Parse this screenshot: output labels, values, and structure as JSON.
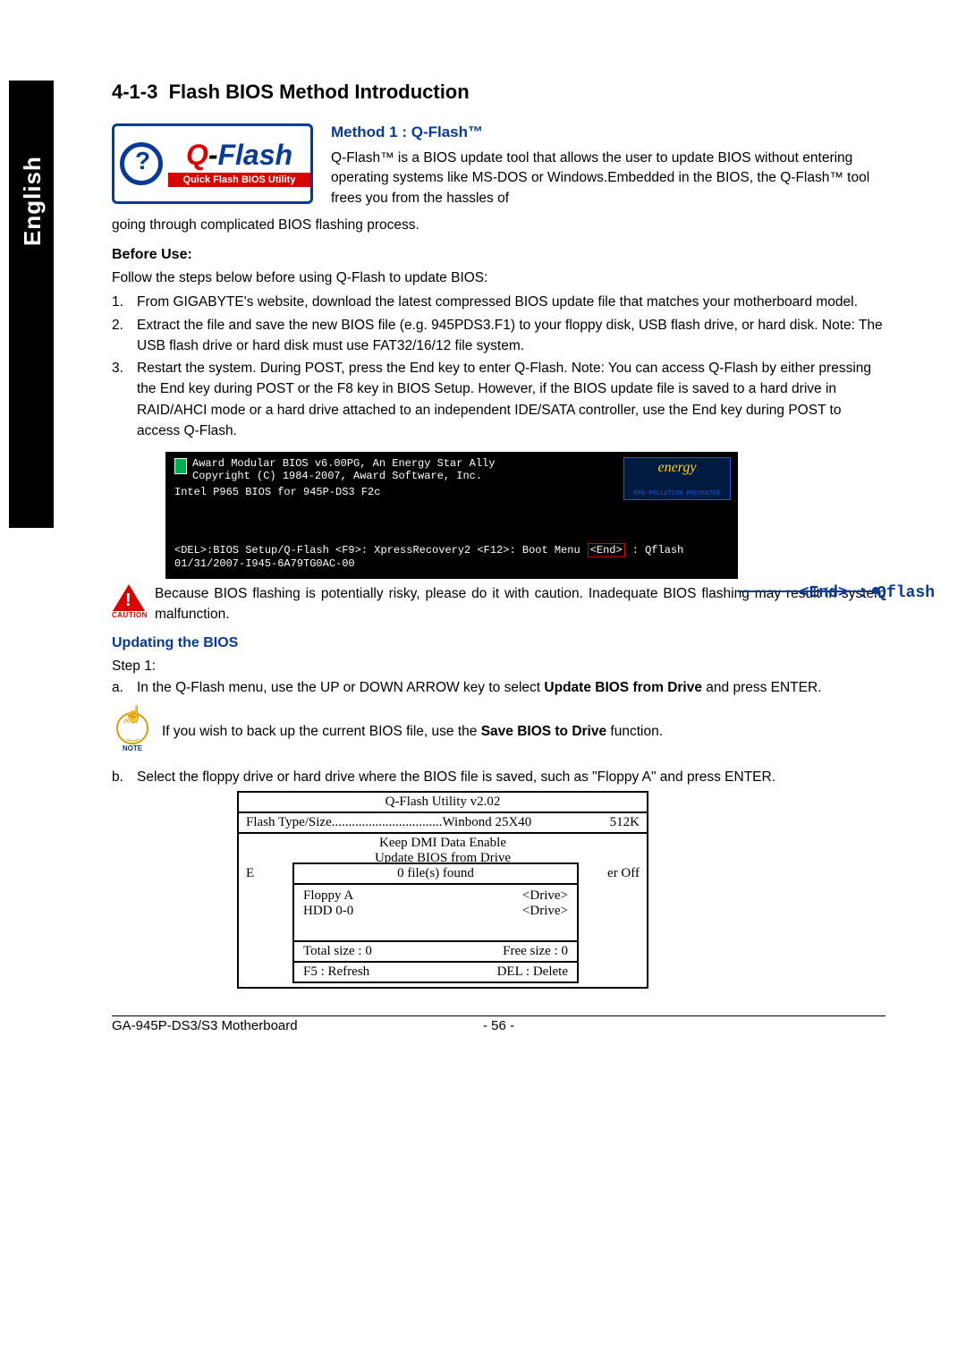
{
  "section_number": "4-1-3",
  "section_title": "Flash BIOS Method Introduction",
  "language_tab": "English",
  "logo": {
    "name_q": "Q",
    "name_flash": "Flash",
    "subtitle": "Quick Flash BIOS Utility"
  },
  "method1": {
    "heading": "Method 1 : Q-Flash™",
    "para_a": "Q-Flash™ is a BIOS update tool that allows the user to update BIOS without entering operating systems like MS-DOS or Windows.Embedded in the BIOS, the Q-Flash™ tool frees you from the hassles of",
    "para_b": "going through complicated BIOS flashing process."
  },
  "before_use": {
    "heading": "Before Use:",
    "intro": "Follow the steps below before using Q-Flash to update BIOS:",
    "items": [
      "From GIGABYTE's website, download the latest compressed BIOS update file that matches your motherboard model.",
      "Extract the file and save the new BIOS file (e.g. 945PDS3.F1) to your floppy disk, USB flash drive, or hard disk. Note: The USB flash drive or hard disk must use FAT32/16/12 file system.",
      "Restart the system. During POST, press the End key to enter Q-Flash.  Note: You can access Q-Flash by either pressing the End key during POST or the F8 key in BIOS Setup. However, if the BIOS update file is saved to a hard drive in RAID/AHCI mode or a hard drive attached to an independent IDE/SATA controller, use the End key during POST to access Q-Flash."
    ]
  },
  "bios_screen": {
    "line1": "Award Modular BIOS v6.00PG, An Energy Star Ally",
    "line2": "Copyright (C) 1984-2007, Award Software, Inc.",
    "line3": "Intel P965 BIOS for 945P-DS3 F2c",
    "bottom_pre": "<DEL>:BIOS Setup/Q-Flash <F9>: XpressRecovery2 <F12>: Boot Menu",
    "bottom_end": "<End>",
    "bottom_post": ": Qflash",
    "serial": "01/31/2007-I945-6A79TG0AC-00",
    "energy_script": "energy",
    "energy_sub": "EPA POLLUTION PREVENTER",
    "callout": "<End> : Qflash"
  },
  "caution": {
    "label": "CAUTION",
    "text": "Because BIOS flashing is potentially risky, please do it with caution. Inadequate BIOS flashing may result in system malfunction."
  },
  "updating": {
    "heading": "Updating the BIOS",
    "step_label": "Step 1:",
    "a_pre": "In the Q-Flash menu, use the UP or DOWN ARROW key to select ",
    "a_bold": "Update BIOS from Drive",
    "a_post": " and press ENTER.",
    "note_label": "NOTE",
    "note_pre": "If you wish to back up the current BIOS file, use the ",
    "note_bold": "Save BIOS to Drive",
    "note_post": " function.",
    "b_text": "Select the floppy drive or hard drive where the BIOS file is saved, such as \"Floppy A\" and press ENTER."
  },
  "qflash_util": {
    "title": "Q-Flash Utility v2.02",
    "row1_left": "Flash Type/Size",
    "row1_mid": "Winbond 25X40",
    "row1_right": "512K",
    "row2a": "Keep DMI Data    Enable",
    "row2b": "Update BIOS from Drive",
    "popup_head": "0 file(s) found",
    "row3a_left": "E",
    "row3b_right": "er Off",
    "drive1_l": "Floppy A",
    "drive1_r": "<Drive>",
    "drive2_l": "HDD 0-0",
    "drive2_r": "<Drive>",
    "foot1_l": "Total size : 0",
    "foot1_r": "Free size : 0",
    "foot2_l": "F5 : Refresh",
    "foot2_r": "DEL : Delete"
  },
  "footer": {
    "left": "GA-945P-DS3/S3 Motherboard",
    "center": "- 56 -"
  }
}
